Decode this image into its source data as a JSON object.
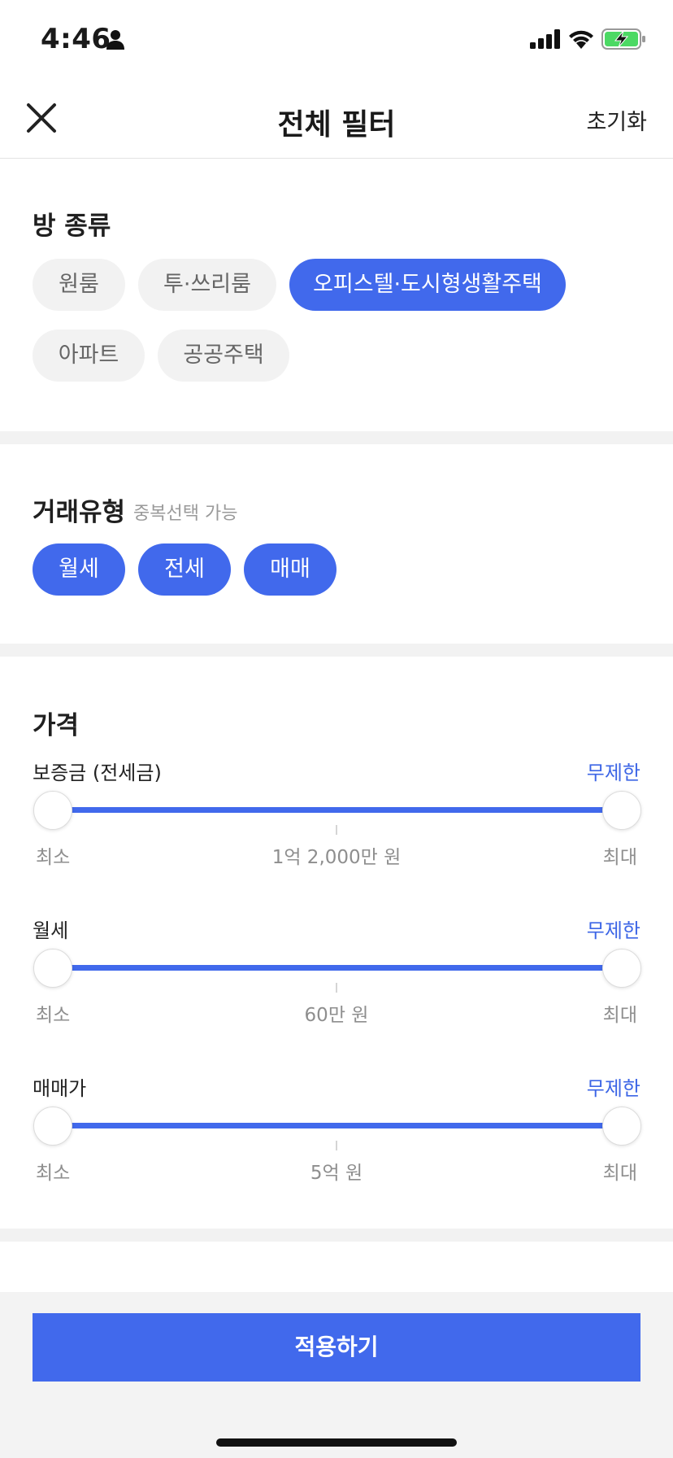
{
  "status_bar": {
    "time": "4:46",
    "icons": [
      "person-icon",
      "signal-icon",
      "wifi-icon",
      "battery-charging-icon"
    ]
  },
  "header": {
    "title": "전체 필터",
    "reset_label": "초기화",
    "close_icon": "close-icon"
  },
  "room_type": {
    "title": "방 종류",
    "options": [
      {
        "label": "원룸",
        "selected": false
      },
      {
        "label": "투·쓰리룸",
        "selected": false
      },
      {
        "label": "오피스텔·도시형생활주택",
        "selected": true
      },
      {
        "label": "아파트",
        "selected": false
      },
      {
        "label": "공공주택",
        "selected": false
      }
    ]
  },
  "deal_type": {
    "title": "거래유형",
    "hint": "중복선택 가능",
    "options": [
      {
        "label": "월세",
        "selected": true
      },
      {
        "label": "전세",
        "selected": true
      },
      {
        "label": "매매",
        "selected": true
      }
    ]
  },
  "price": {
    "title": "가격",
    "sliders": [
      {
        "label": "보증금 (전세금)",
        "value_label": "무제한",
        "min_label": "최소",
        "mid_label": "1억 2,000만 원",
        "max_label": "최대",
        "range": [
          0,
          1
        ]
      },
      {
        "label": "월세",
        "value_label": "무제한",
        "min_label": "최소",
        "mid_label": "60만 원",
        "max_label": "최대",
        "range": [
          0,
          1
        ]
      },
      {
        "label": "매매가",
        "value_label": "무제한",
        "min_label": "최소",
        "mid_label": "5억 원",
        "max_label": "최대",
        "range": [
          0,
          1
        ]
      }
    ]
  },
  "footer": {
    "apply_label": "적용하기"
  },
  "colors": {
    "accent": "#4169ec",
    "chip_off_bg": "#f2f2f2",
    "divider": "#f2f2f2"
  }
}
